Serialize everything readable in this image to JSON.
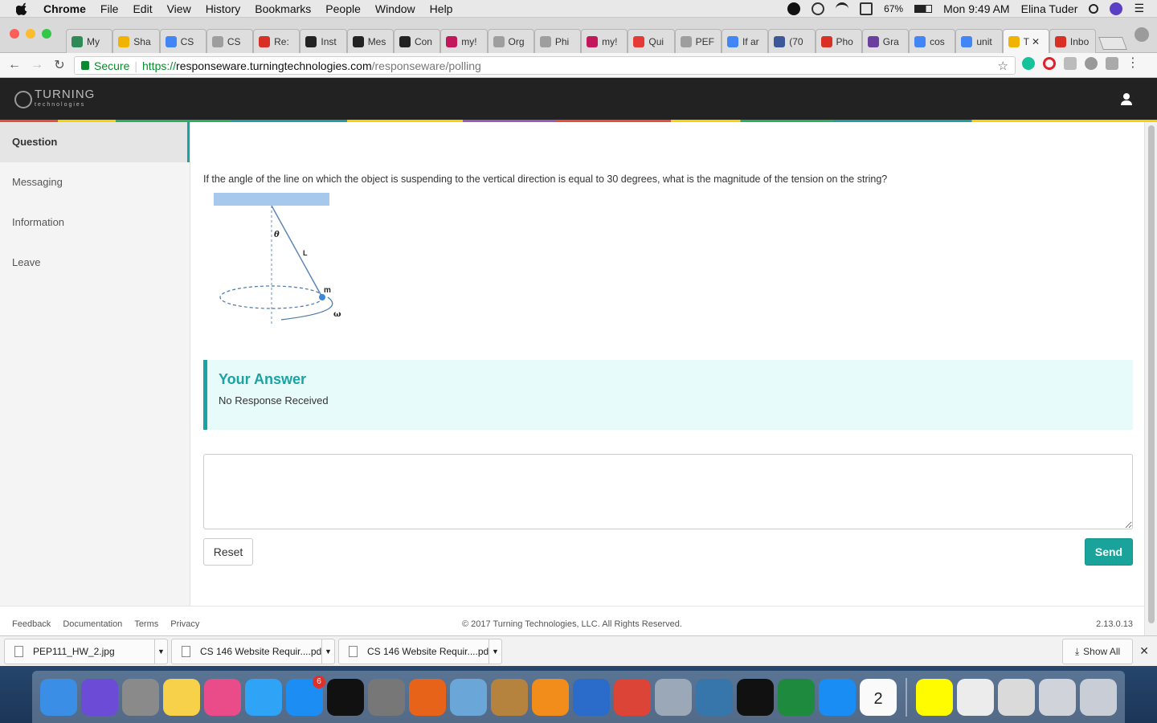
{
  "menubar": {
    "app": "Chrome",
    "items": [
      "File",
      "Edit",
      "View",
      "History",
      "Bookmarks",
      "People",
      "Window",
      "Help"
    ],
    "battery": "67%",
    "clock": "Mon 9:49 AM",
    "user": "Elina Tuder"
  },
  "tabs": [
    {
      "label": "My",
      "color": "#2e8b57"
    },
    {
      "label": "Sha",
      "color": "#f0b400"
    },
    {
      "label": "CS",
      "color": "#4285f4"
    },
    {
      "label": "CS",
      "color": "#9e9e9e"
    },
    {
      "label": "Re:",
      "color": "#d93025"
    },
    {
      "label": "Inst",
      "color": "#222222"
    },
    {
      "label": "Mes",
      "color": "#222222"
    },
    {
      "label": "Con",
      "color": "#222222"
    },
    {
      "label": "my!",
      "color": "#c2185b"
    },
    {
      "label": "Org",
      "color": "#9e9e9e"
    },
    {
      "label": "Phi",
      "color": "#9e9e9e"
    },
    {
      "label": "my!",
      "color": "#c2185b"
    },
    {
      "label": "Qui",
      "color": "#e53935"
    },
    {
      "label": "PEF",
      "color": "#9e9e9e"
    },
    {
      "label": "If ar",
      "color": "#4285f4"
    },
    {
      "label": "(70",
      "color": "#3b5998"
    },
    {
      "label": "Pho",
      "color": "#d93025"
    },
    {
      "label": "Gra",
      "color": "#6a3fa0"
    },
    {
      "label": "cos",
      "color": "#4285f4"
    },
    {
      "label": "unit",
      "color": "#4285f4"
    },
    {
      "label": "T",
      "color": "#f0b400",
      "active": true
    },
    {
      "label": "Inbo",
      "color": "#d93025"
    }
  ],
  "address": {
    "secure_label": "Secure",
    "scheme": "https://",
    "host": "responseware.turningtechnologies.com",
    "path": "/responseware/polling"
  },
  "app": {
    "brand_name": "TURNING",
    "brand_sub": "technologies",
    "sidebar": [
      {
        "label": "Question",
        "active": true
      },
      {
        "label": "Messaging"
      },
      {
        "label": "Information"
      },
      {
        "label": "Leave"
      }
    ],
    "question_text": "If the angle of the line on which the object is suspending to the vertical direction is equal to 30 degrees, what is the magnitude of the tension on the string?",
    "diagram_labels": {
      "theta": "θ",
      "length": "L",
      "mass": "m",
      "omega": "ω"
    },
    "answer_title": "Your Answer",
    "answer_value": "No Response Received",
    "response_value": "",
    "reset_label": "Reset",
    "send_label": "Send",
    "accent": "#1aa3a3"
  },
  "footer": {
    "links": [
      "Feedback",
      "Documentation",
      "Terms",
      "Privacy"
    ],
    "copyright": "© 2017 Turning Technologies, LLC. All Rights Reserved.",
    "version": "2.13.0.13"
  },
  "downloads": [
    {
      "name": "PEP111_HW_2.jpg"
    },
    {
      "name": "CS 146 Website Requir....pdf"
    },
    {
      "name": "CS 146 Website Requir....pdf"
    }
  ],
  "show_all_label": "Show All",
  "dock": [
    {
      "name": "finder-icon",
      "color": "#3a8ee6"
    },
    {
      "name": "siri-icon",
      "color": "#6c4bd6"
    },
    {
      "name": "calculator-icon",
      "color": "#8a8a8a"
    },
    {
      "name": "notes-icon",
      "color": "#f7d14a"
    },
    {
      "name": "itunes-icon",
      "color": "#ea4c89"
    },
    {
      "name": "messages-icon",
      "color": "#2fa3f5"
    },
    {
      "name": "app-store-icon",
      "color": "#1c8df2",
      "badge": "6"
    },
    {
      "name": "activity-monitor-icon",
      "color": "#111111"
    },
    {
      "name": "system-preferences-icon",
      "color": "#777777"
    },
    {
      "name": "firefox-icon",
      "color": "#e8631a"
    },
    {
      "name": "preview-icon",
      "color": "#6aa6d8"
    },
    {
      "name": "contacts-icon",
      "color": "#b5833d"
    },
    {
      "name": "vlc-icon",
      "color": "#f28c1b"
    },
    {
      "name": "word-icon",
      "color": "#2b6bc9"
    },
    {
      "name": "chrome-icon",
      "color": "#db4437"
    },
    {
      "name": "photos-icon",
      "color": "#9aa8b8"
    },
    {
      "name": "python-icon",
      "color": "#3776ab"
    },
    {
      "name": "terminal-icon",
      "color": "#111111"
    },
    {
      "name": "excel-icon",
      "color": "#1e8a3e"
    },
    {
      "name": "safari-icon",
      "color": "#1a8df5"
    },
    {
      "name": "calendar-icon",
      "color": "#fafafa",
      "text": "2"
    },
    {
      "name": "snapchat-icon",
      "color": "#fffc00"
    },
    {
      "name": "document-icon",
      "color": "#ececec"
    },
    {
      "name": "screenshot-icon",
      "color": "#dadada"
    },
    {
      "name": "folder-stack-icon",
      "color": "#d0d4da"
    },
    {
      "name": "trash-icon",
      "color": "#c9ced6"
    }
  ]
}
